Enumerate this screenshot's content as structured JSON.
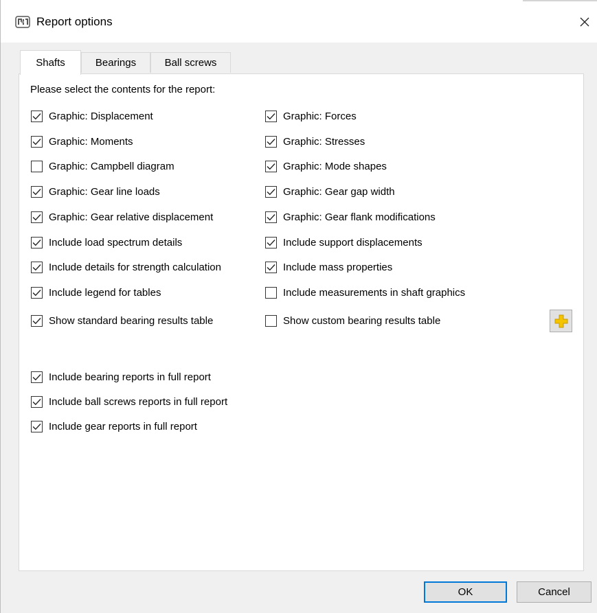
{
  "window": {
    "title": "Report options"
  },
  "tabs": [
    {
      "label": "Shafts",
      "active": true
    },
    {
      "label": "Bearings",
      "active": false
    },
    {
      "label": "Ball screws",
      "active": false
    }
  ],
  "shafts": {
    "intro": "Please select the contents for the report:",
    "left_options": [
      {
        "label": "Graphic: Displacement",
        "checked": true
      },
      {
        "label": "Graphic: Moments",
        "checked": true
      },
      {
        "label": "Graphic: Campbell diagram",
        "checked": false
      },
      {
        "label": "Graphic: Gear line loads",
        "checked": true
      },
      {
        "label": "Graphic: Gear relative displacement",
        "checked": true
      },
      {
        "label": "Include load spectrum details",
        "checked": true
      },
      {
        "label": "Include details for strength calculation",
        "checked": true
      },
      {
        "label": "Include legend for tables",
        "checked": true
      },
      {
        "label": "Show standard bearing results table",
        "checked": true
      }
    ],
    "right_options": [
      {
        "label": "Graphic: Forces",
        "checked": true
      },
      {
        "label": "Graphic: Stresses",
        "checked": true
      },
      {
        "label": "Graphic: Mode shapes",
        "checked": true
      },
      {
        "label": "Graphic: Gear gap width",
        "checked": true
      },
      {
        "label": "Graphic: Gear flank modifications",
        "checked": true
      },
      {
        "label": "Include support displacements",
        "checked": true
      },
      {
        "label": "Include mass properties",
        "checked": true
      },
      {
        "label": "Include measurements in shaft graphics",
        "checked": false
      },
      {
        "label": "Show custom bearing results table",
        "checked": false
      }
    ],
    "full_report_options": [
      {
        "label": "Include bearing reports in full report",
        "checked": true
      },
      {
        "label": "Include ball screws reports in full report",
        "checked": true
      },
      {
        "label": "Include gear reports in full report",
        "checked": true
      }
    ],
    "custom_table_button_icon": "plus-icon"
  },
  "buttons": {
    "ok": "OK",
    "cancel": "Cancel"
  },
  "colors": {
    "accent": "#0078d7",
    "plus_icon": "#f5c400"
  }
}
